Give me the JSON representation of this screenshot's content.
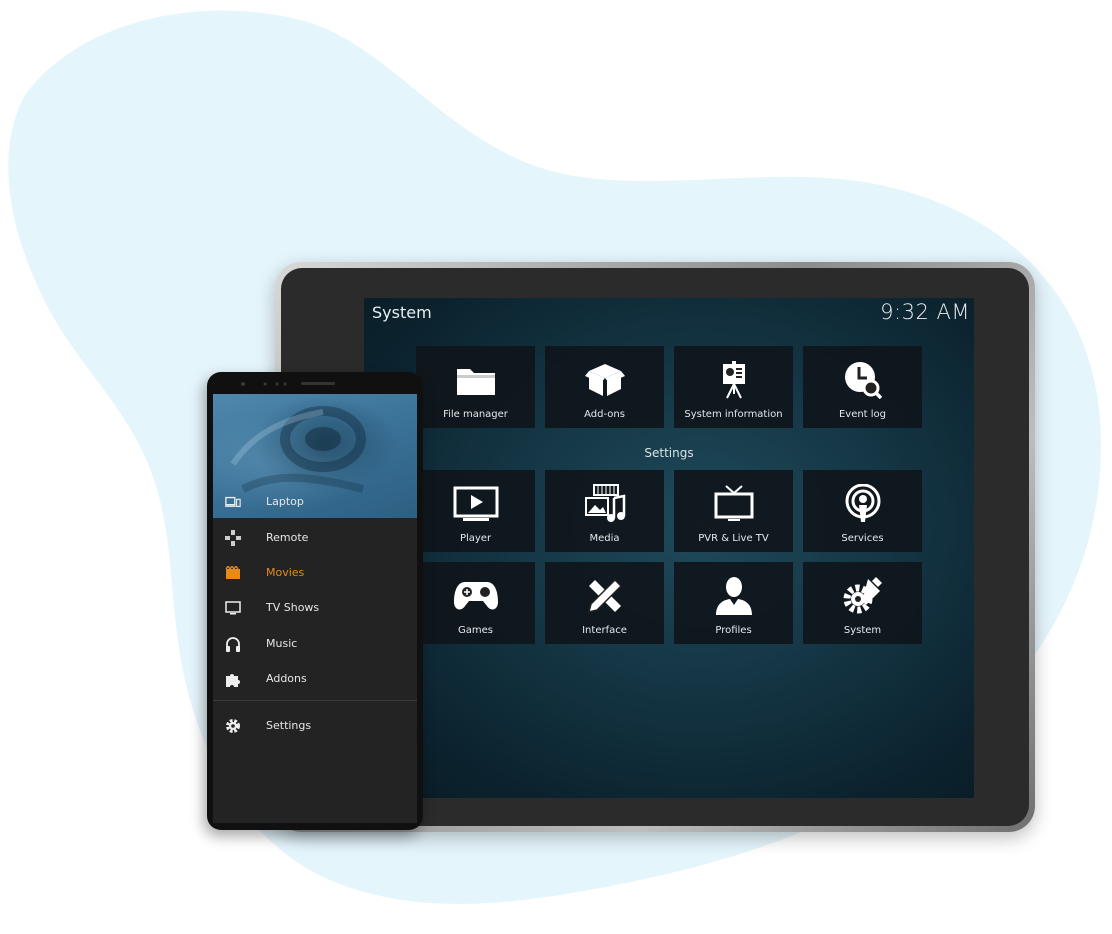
{
  "tablet": {
    "title": "System",
    "clock": "9:32 AM",
    "section_label": "Settings",
    "top_tiles": [
      {
        "label": "File manager",
        "icon": "folder-icon"
      },
      {
        "label": "Add-ons",
        "icon": "box-icon"
      },
      {
        "label": "System information",
        "icon": "presentation-icon"
      },
      {
        "label": "Event log",
        "icon": "clock-search-icon"
      }
    ],
    "settings_tiles": [
      {
        "label": "Player",
        "icon": "play-screen-icon"
      },
      {
        "label": "Media",
        "icon": "media-icon"
      },
      {
        "label": "PVR & Live TV",
        "icon": "tv-icon"
      },
      {
        "label": "Services",
        "icon": "podcast-icon"
      },
      {
        "label": "Games",
        "icon": "gamepad-icon"
      },
      {
        "label": "Interface",
        "icon": "pencil-ruler-icon"
      },
      {
        "label": "Profiles",
        "icon": "user-icon"
      },
      {
        "label": "System",
        "icon": "gears-icon"
      }
    ]
  },
  "phone": {
    "menu": [
      {
        "label": "Laptop",
        "icon": "devices-icon"
      },
      {
        "label": "Remote",
        "icon": "dpad-icon"
      },
      {
        "label": "Movies",
        "icon": "clapper-icon",
        "active": true
      },
      {
        "label": "TV Shows",
        "icon": "monitor-icon"
      },
      {
        "label": "Music",
        "icon": "headphones-icon"
      },
      {
        "label": "Addons",
        "icon": "puzzle-icon"
      },
      {
        "label": "Settings",
        "icon": "gear-icon"
      }
    ]
  },
  "colors": {
    "accent": "#e88a1a",
    "screen_bg": "#153645",
    "tile_bg": "#0f161b",
    "blob": "#e4f5fb"
  }
}
